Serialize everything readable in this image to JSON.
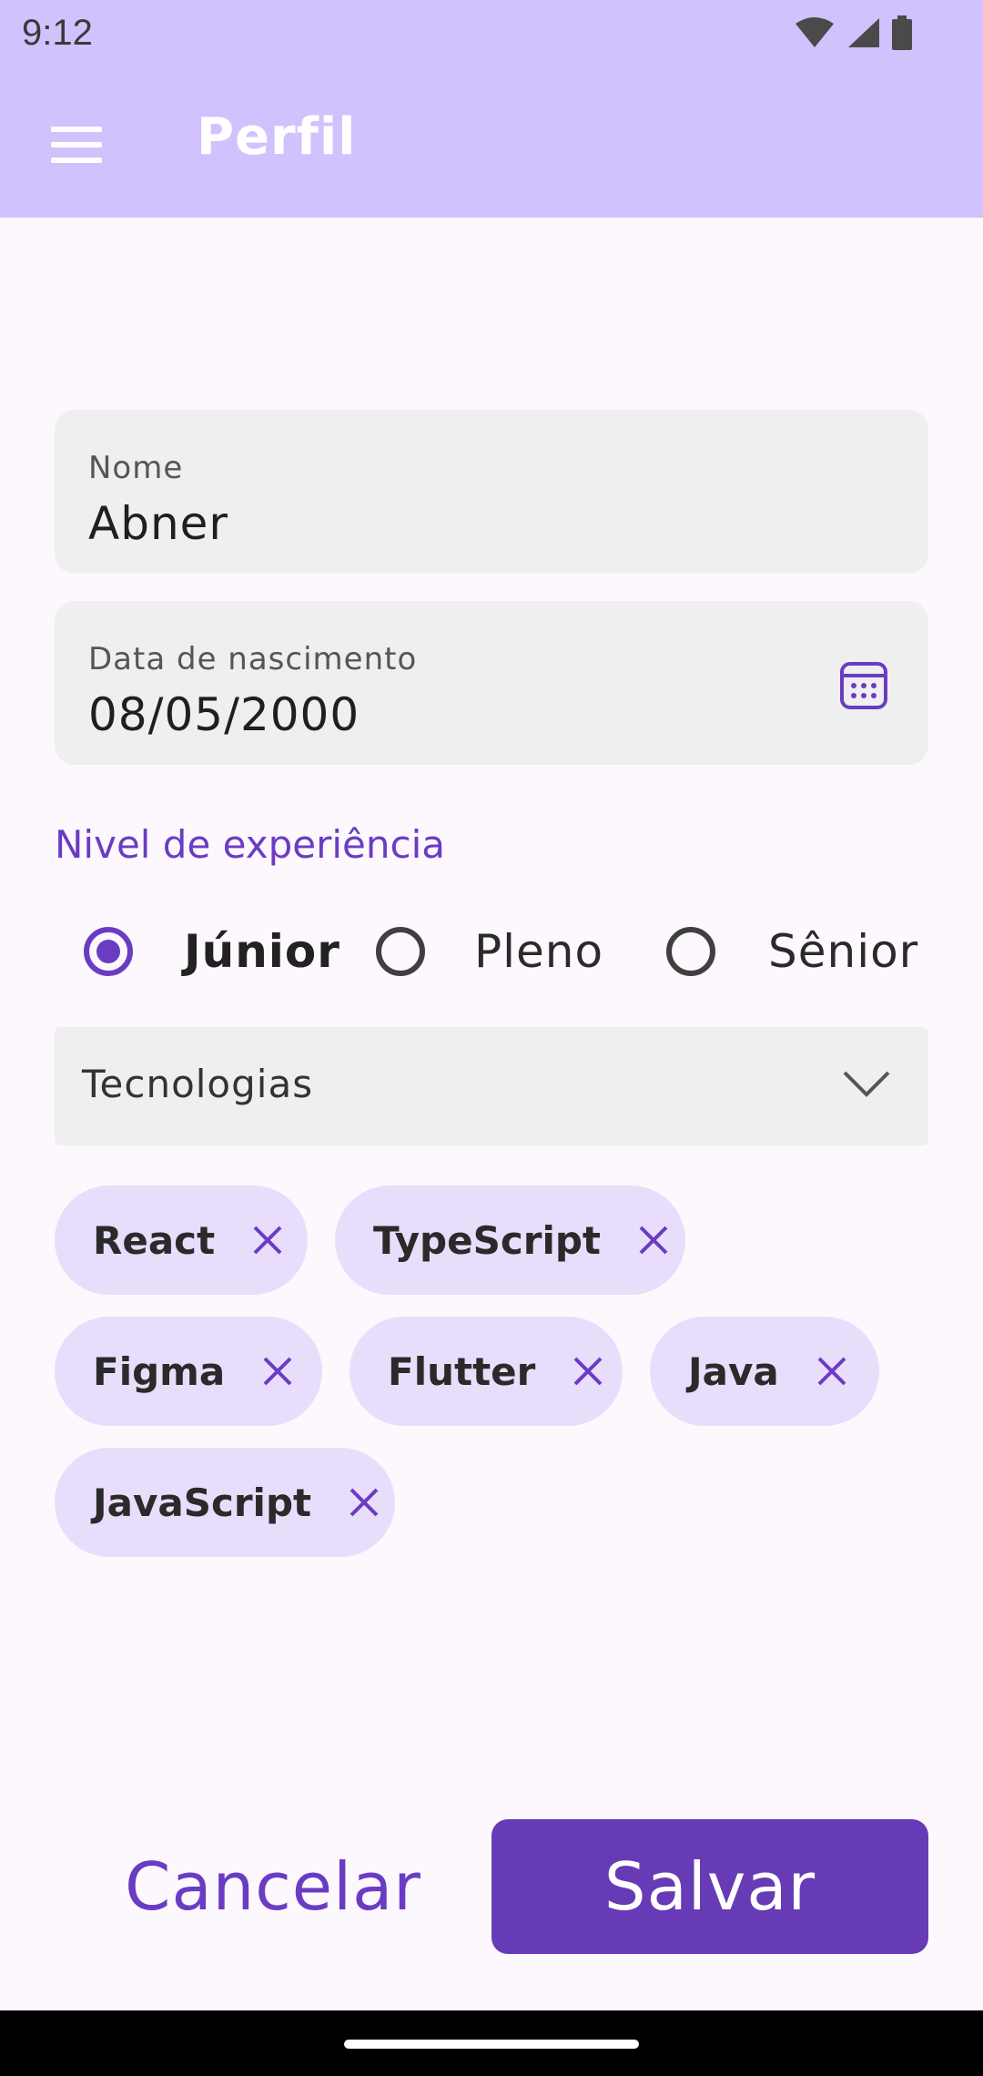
{
  "status_bar": {
    "time": "9:12"
  },
  "app_bar": {
    "title": "Perfil"
  },
  "form": {
    "name": {
      "label": "Nome",
      "value": "Abner"
    },
    "birthdate": {
      "label": "Data de nascimento",
      "value": "08/05/2000"
    },
    "experience": {
      "label": "Nivel de experiência",
      "options": [
        "Júnior",
        "Pleno",
        "Sênior"
      ],
      "selected": "Júnior"
    },
    "technologies": {
      "placeholder": "Tecnologias",
      "chips": [
        "React",
        "TypeScript",
        "Figma",
        "Flutter",
        "Java",
        "JavaScript"
      ]
    }
  },
  "actions": {
    "cancel": "Cancelar",
    "save": "Salvar"
  },
  "colors": {
    "app_bar": "#d1c1fc",
    "accent": "#673ab6",
    "chip": "#e9ddfc"
  },
  "icons": [
    "menu-icon",
    "wifi-icon",
    "signal-icon",
    "battery-icon",
    "calendar-icon",
    "chevron-down-icon",
    "close-icon"
  ]
}
